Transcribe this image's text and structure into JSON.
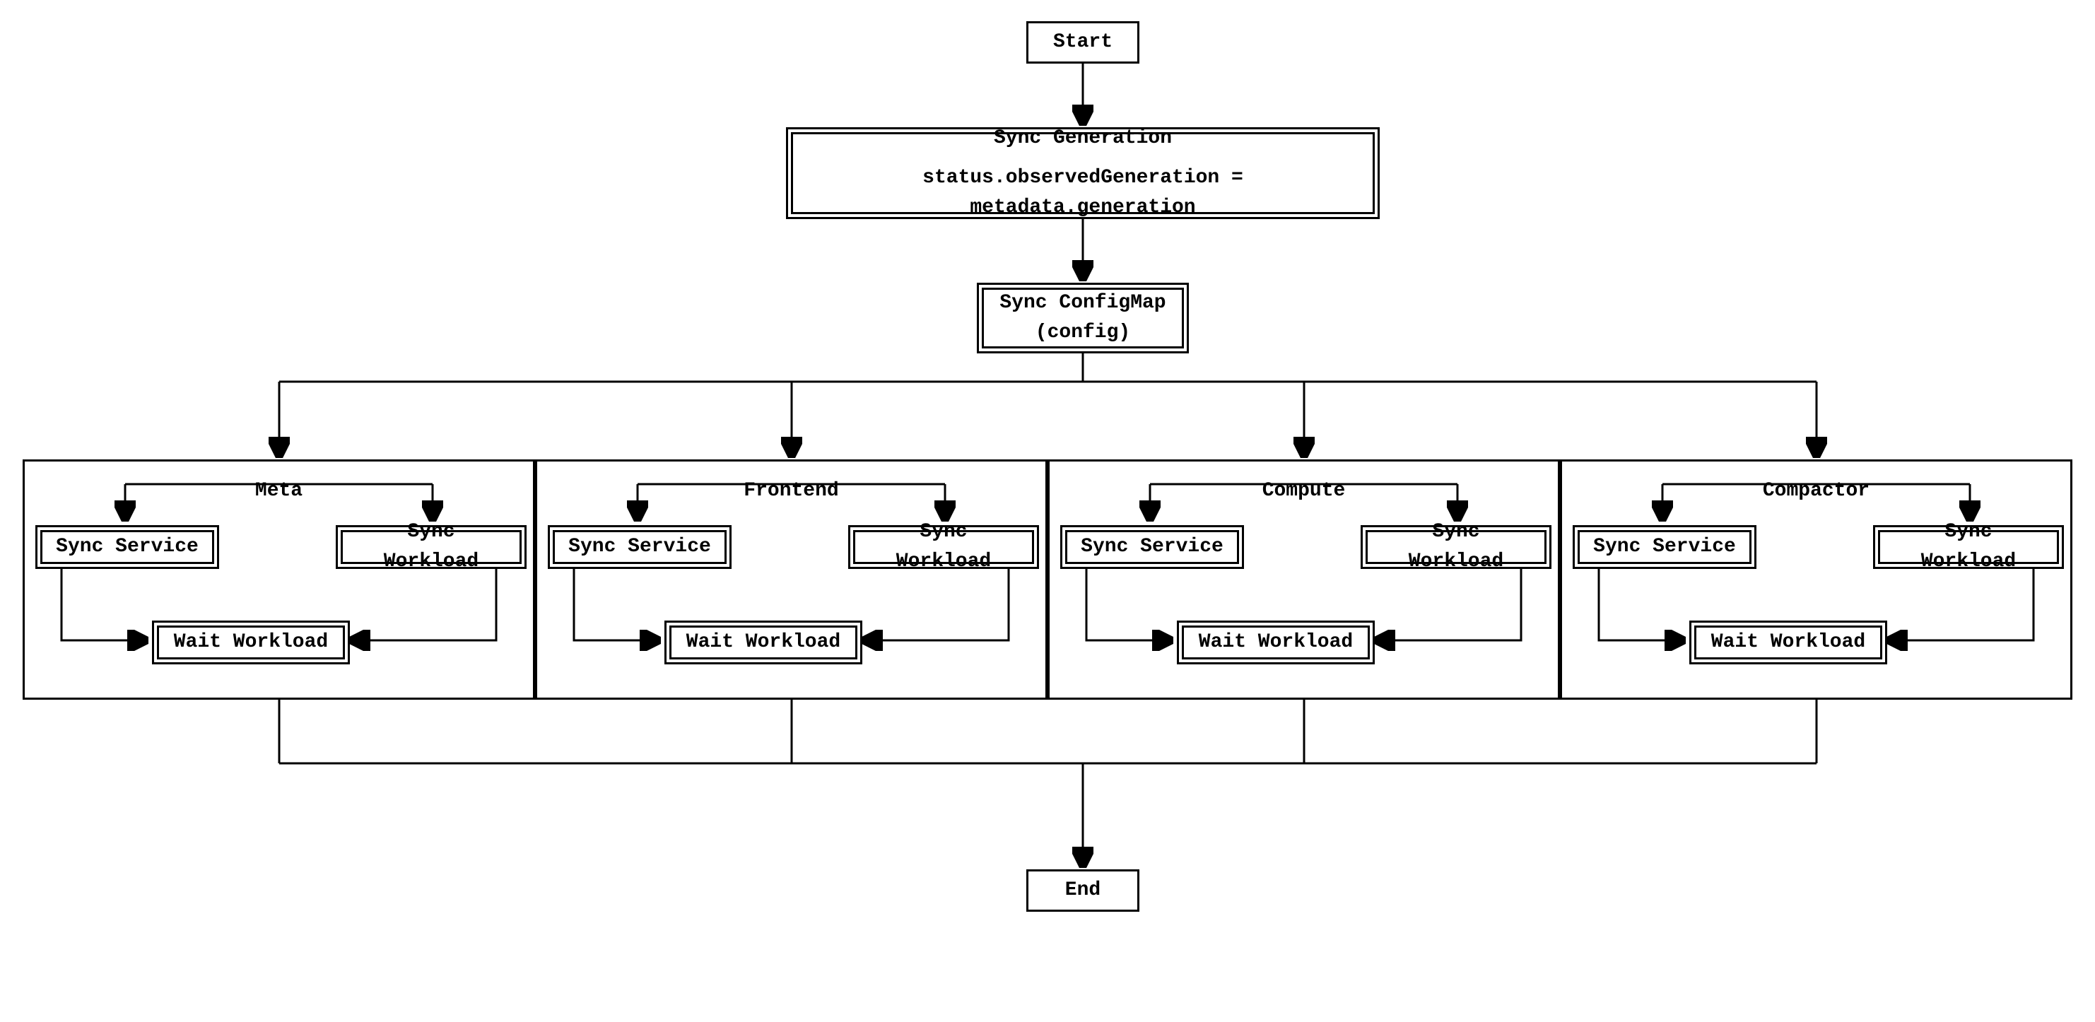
{
  "nodes": {
    "start": "Start",
    "syncGen": {
      "title": "Sync Generation",
      "detail": "status.observedGeneration = metadata.generation"
    },
    "syncConfigMap": {
      "title": "Sync ConfigMap",
      "detail": "(config)"
    },
    "end": "End"
  },
  "subgraphs": [
    {
      "name": "Meta",
      "syncService": "Sync Service",
      "syncWorkload": "Sync Workload",
      "waitWorkload": "Wait Workload"
    },
    {
      "name": "Frontend",
      "syncService": "Sync Service",
      "syncWorkload": "Sync Workload",
      "waitWorkload": "Wait Workload"
    },
    {
      "name": "Compute",
      "syncService": "Sync Service",
      "syncWorkload": "Sync Workload",
      "waitWorkload": "Wait Workload"
    },
    {
      "name": "Compactor",
      "syncService": "Sync Service",
      "syncWorkload": "Sync Workload",
      "waitWorkload": "Wait Workload"
    }
  ],
  "flow": {
    "description": "Reconciliation flowchart: Start -> Sync Generation -> Sync ConfigMap -> parallel {Meta, Frontend, Compute, Compactor} each doing Sync Service + Sync Workload -> Wait Workload -> join -> End",
    "edges": [
      [
        "Start",
        "Sync Generation"
      ],
      [
        "Sync Generation",
        "Sync ConfigMap"
      ],
      [
        "Sync ConfigMap",
        "Meta"
      ],
      [
        "Sync ConfigMap",
        "Frontend"
      ],
      [
        "Sync ConfigMap",
        "Compute"
      ],
      [
        "Sync ConfigMap",
        "Compactor"
      ],
      [
        "Meta.Sync Service",
        "Meta.Wait Workload"
      ],
      [
        "Meta.Sync Workload",
        "Meta.Wait Workload"
      ],
      [
        "Frontend.Sync Service",
        "Frontend.Wait Workload"
      ],
      [
        "Frontend.Sync Workload",
        "Frontend.Wait Workload"
      ],
      [
        "Compute.Sync Service",
        "Compute.Wait Workload"
      ],
      [
        "Compute.Sync Workload",
        "Compute.Wait Workload"
      ],
      [
        "Compactor.Sync Service",
        "Compactor.Wait Workload"
      ],
      [
        "Compactor.Sync Workload",
        "Compactor.Wait Workload"
      ],
      [
        "Meta",
        "End"
      ],
      [
        "Frontend",
        "End"
      ],
      [
        "Compute",
        "End"
      ],
      [
        "Compactor",
        "End"
      ]
    ]
  }
}
